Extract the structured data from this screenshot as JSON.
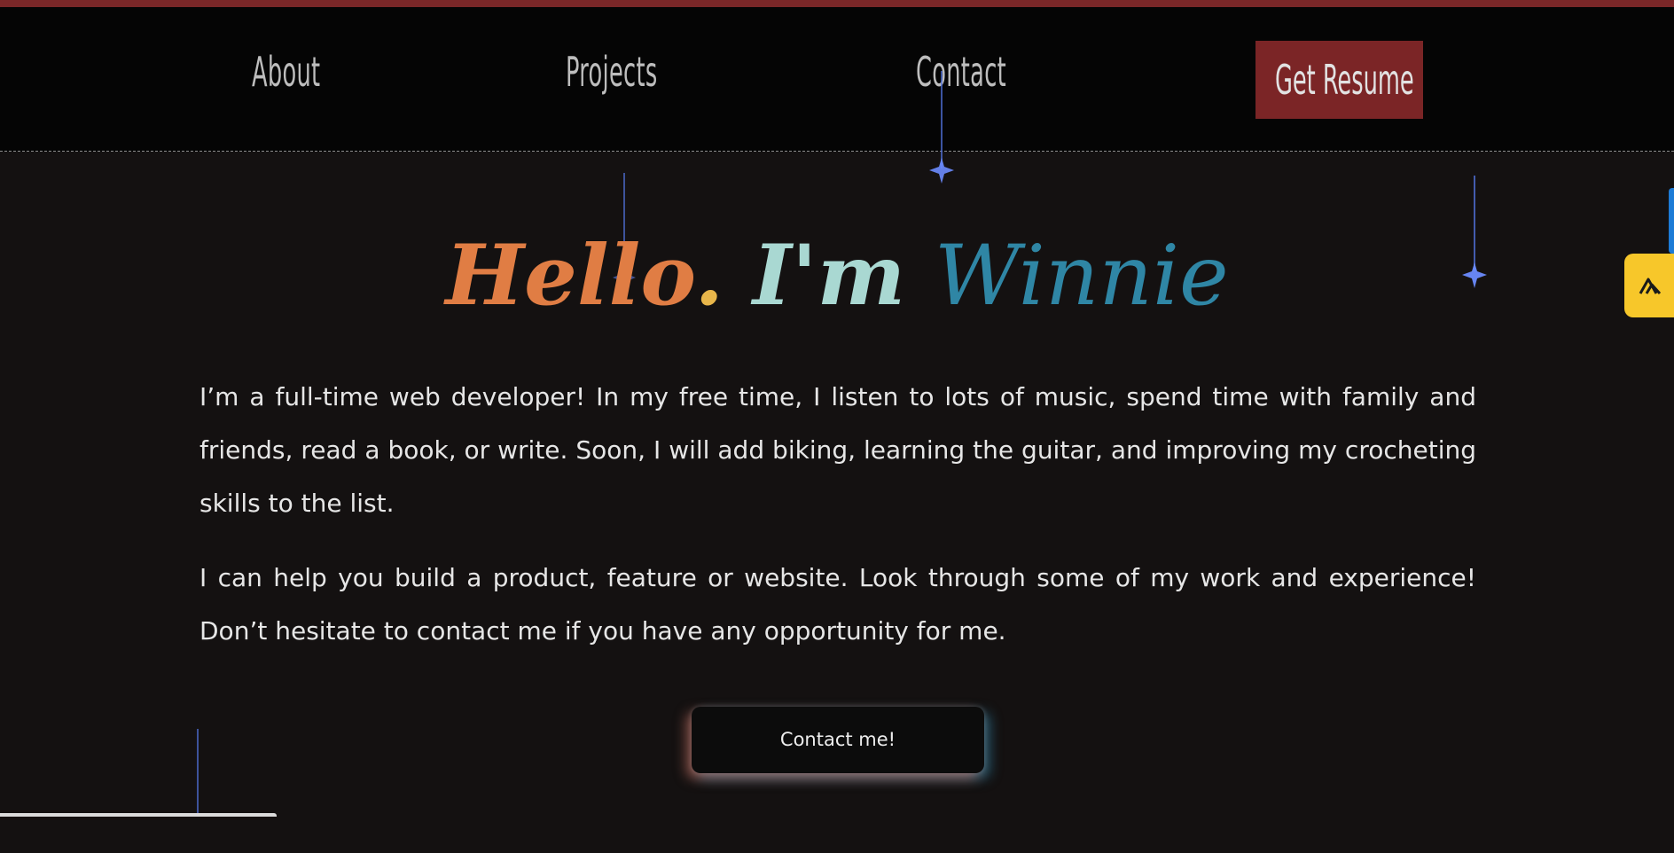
{
  "nav": {
    "about": "About",
    "projects": "Projects",
    "contact": "Contact",
    "resume": "Get Resume"
  },
  "hero": {
    "hello": "Hello",
    "dot": ".",
    "im": "I'm",
    "name": "Winnie"
  },
  "bio": {
    "p1": "I’m a full-time web developer! In my free time, I listen to lots of music, spend time with family and friends, read a book, or write. Soon, I will add biking, learning the guitar, and improving my crocheting skills to the list.",
    "p2": "I can help you build a product, feature or website. Look through some of my work and experience! Don’t hesitate to contact me if you have any opportunity for me."
  },
  "cta": {
    "label": "Contact me!"
  },
  "icons": {
    "sparkle": "shooting-star-icon",
    "side_widget": "stacked-triangles-icon"
  },
  "colors": {
    "accent_red": "#7b2526",
    "hello": "#e07d44",
    "dot": "#e8b64a",
    "im": "#a9d8d2",
    "name": "#2f86a5",
    "widget": "#f7c72a",
    "background": "#141111"
  }
}
